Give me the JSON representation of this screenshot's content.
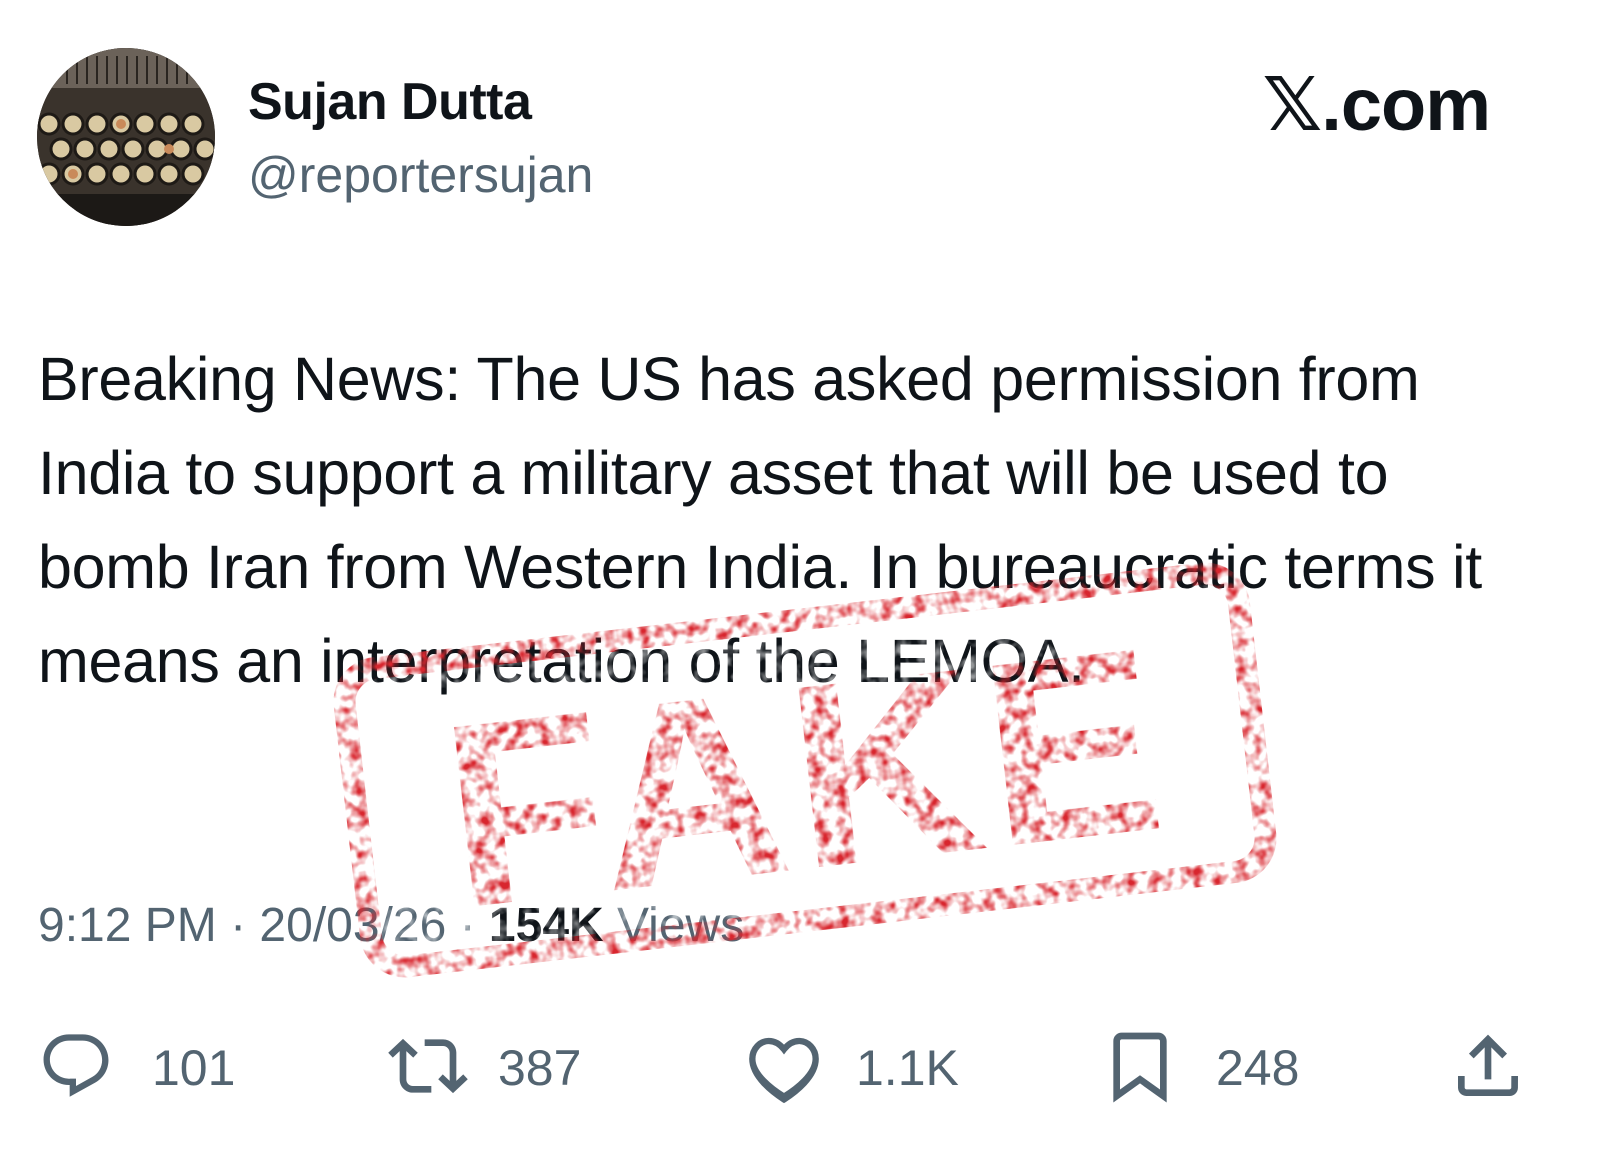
{
  "author": {
    "display_name": "Sujan Dutta",
    "handle": "@reportersujan",
    "avatar_icon": "typewriter-keys-avatar"
  },
  "brand": {
    "label": "𝕏.com"
  },
  "post": {
    "text": "Breaking News: The US has asked permission from India to support a military asset that will be used to bomb Iran from Western India. In bureaucratic terms it means an interpretation of the LEMOA."
  },
  "meta": {
    "time": "9:12 PM",
    "separator": " · ",
    "date": "20/03/26",
    "views_count": "154K",
    "views_label": "Views"
  },
  "stamp": {
    "label": "FAKE",
    "color": "#d8262e"
  },
  "actions": {
    "reply": {
      "icon": "reply-icon",
      "count": "101"
    },
    "repost": {
      "icon": "repost-icon",
      "count": "387"
    },
    "like": {
      "icon": "heart-icon",
      "count": "1.1K"
    },
    "bookmark": {
      "icon": "bookmark-icon",
      "count": "248"
    },
    "share": {
      "icon": "share-icon"
    }
  },
  "colors": {
    "text_primary": "#0f1419",
    "text_secondary": "#536471",
    "stamp_red": "#d8262e"
  }
}
